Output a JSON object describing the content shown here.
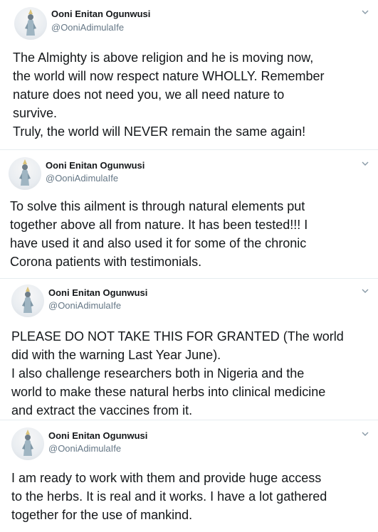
{
  "tweets": [
    {
      "name": "Ooni Enitan Ogunwusi",
      "handle": "@OoniAdimulaIfe",
      "lines": [
        "The Almighty is above religion and he is moving now,",
        "the world will now respect nature WHOLLY. Remember",
        "nature does not need you, we all need nature to",
        "survive.",
        "Truly, the world will NEVER remain the same again!"
      ]
    },
    {
      "name": "Ooni Enitan Ogunwusi",
      "handle": "@OoniAdimulaIfe",
      "lines": [
        "To solve this ailment is through natural elements put",
        "together above all from nature. It has been tested!!! I",
        "have used it and also used it for some of the chronic",
        "Corona patients with testimonials."
      ]
    },
    {
      "name": "Ooni Enitan Ogunwusi",
      "handle": "@OoniAdimulaIfe",
      "lines": [
        "PLEASE DO NOT TAKE THIS FOR GRANTED (The world",
        "did with the warning Last Year June).",
        "I also challenge researchers both in Nigeria and the",
        "world to make these natural herbs into clinical medicine",
        "and extract the vaccines from it."
      ]
    },
    {
      "name": "Ooni Enitan Ogunwusi",
      "handle": "@OoniAdimulaIfe",
      "lines": [
        "I am ready to work with them and provide huge access",
        "to the herbs. It is real and it works. I have a lot gathered",
        "together for the use of mankind."
      ]
    }
  ],
  "icons": {
    "menu": "chevron-down-icon",
    "avatar": "profile-avatar"
  },
  "colors": {
    "text": "#14171a",
    "muted": "#657786",
    "divider": "#e6ecf0"
  }
}
